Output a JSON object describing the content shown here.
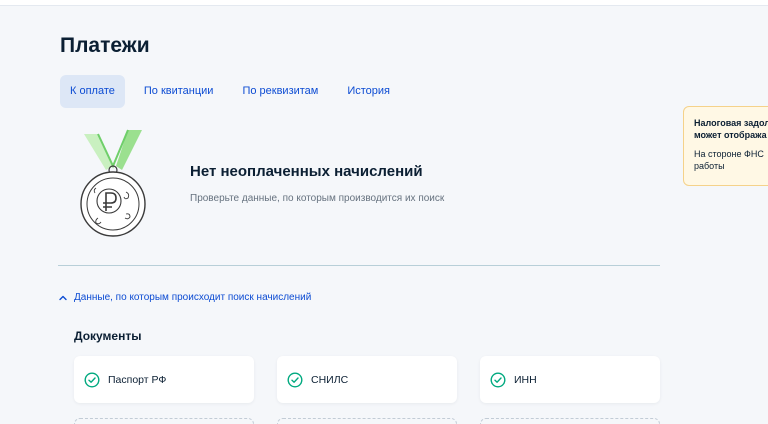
{
  "page": {
    "title": "Платежи"
  },
  "tabs": [
    {
      "label": "К оплате",
      "active": true
    },
    {
      "label": "По квитанции",
      "active": false
    },
    {
      "label": "По реквизитам",
      "active": false
    },
    {
      "label": "История",
      "active": false
    }
  ],
  "empty_state": {
    "icon": "medal-ruble-icon",
    "title": "Нет неоплаченных начислений",
    "subtitle": "Проверьте данные, по которым производится их поиск"
  },
  "search_data": {
    "toggle_icon": "chevron-up-icon",
    "toggle_label": "Данные, по которым происходит поиск начислений",
    "documents_title": "Документы",
    "documents": [
      {
        "label": "Паспорт РФ",
        "icon": "check-circle-icon"
      },
      {
        "label": "СНИЛС",
        "icon": "check-circle-icon"
      },
      {
        "label": "ИНН",
        "icon": "check-circle-icon"
      }
    ]
  },
  "notice": {
    "title": "Налоговая задол\nможет отобража",
    "body": "На стороне ФНС\nработы"
  },
  "colors": {
    "accent": "#0d4cd3",
    "success": "#00a97f",
    "tab_active_bg": "#dde7f6",
    "notice_bg": "#fff8e5"
  }
}
